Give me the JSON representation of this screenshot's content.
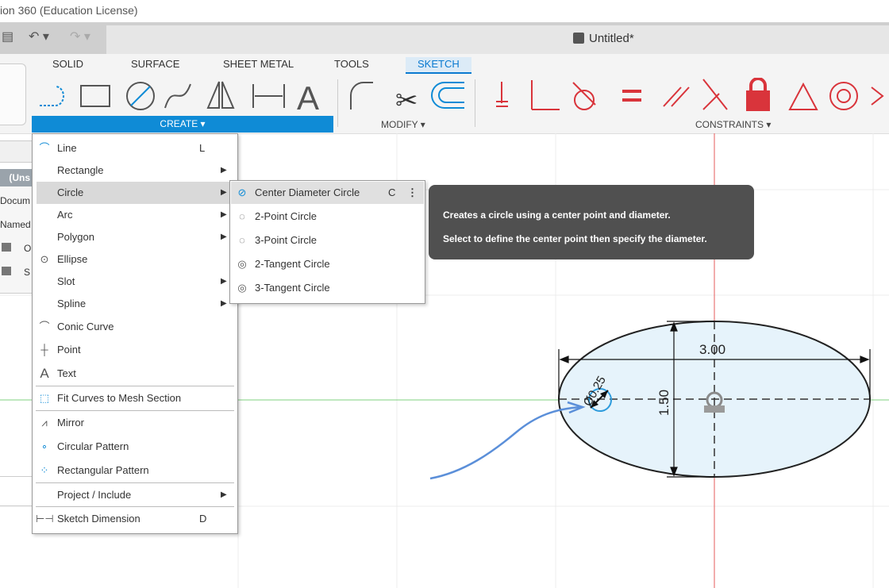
{
  "window": {
    "title_fragment": "ion 360 (Education License)",
    "document_title": "Untitled*"
  },
  "tabs": [
    {
      "label": "SOLID"
    },
    {
      "label": "SURFACE"
    },
    {
      "label": "SHEET METAL"
    },
    {
      "label": "TOOLS"
    },
    {
      "label": "SKETCH",
      "active": true
    }
  ],
  "panels": {
    "create": "CREATE ▾",
    "modify": "MODIFY ▾",
    "constraints": "CONSTRAINTS ▾"
  },
  "browser": {
    "header": "(Uns",
    "items": [
      "Docum",
      "Named",
      "O",
      "S"
    ]
  },
  "create_menu": {
    "items": [
      {
        "label": "Line",
        "shortcut": "L",
        "icon": "line-icon"
      },
      {
        "label": "Rectangle",
        "submenu": true
      },
      {
        "label": "Circle",
        "submenu": true,
        "highlighted": true
      },
      {
        "label": "Arc",
        "submenu": true
      },
      {
        "label": "Polygon",
        "submenu": true
      },
      {
        "label": "Ellipse",
        "icon": "ellipse-icon"
      },
      {
        "label": "Slot",
        "submenu": true
      },
      {
        "label": "Spline",
        "submenu": true
      },
      {
        "label": "Conic Curve",
        "icon": "conic-curve-icon"
      },
      {
        "label": "Point",
        "icon": "point-icon"
      },
      {
        "label": "Text",
        "icon": "text-icon"
      },
      {
        "label": "Fit Curves to Mesh Section",
        "icon": "fit-curves-icon"
      },
      {
        "label": "Mirror",
        "icon": "mirror-icon"
      },
      {
        "label": "Circular Pattern",
        "icon": "circular-pattern-icon"
      },
      {
        "label": "Rectangular Pattern",
        "icon": "rectangular-pattern-icon"
      },
      {
        "label": "Project / Include",
        "submenu": true
      },
      {
        "label": "Sketch Dimension",
        "shortcut": "D",
        "icon": "sketch-dimension-icon"
      }
    ]
  },
  "circle_menu": {
    "items": [
      {
        "label": "Center Diameter Circle",
        "shortcut": "C",
        "highlighted": true
      },
      {
        "label": "2-Point Circle"
      },
      {
        "label": "3-Point Circle"
      },
      {
        "label": "2-Tangent Circle"
      },
      {
        "label": "3-Tangent Circle"
      }
    ],
    "more": "⋮"
  },
  "tooltip": {
    "line1": "Creates a circle using a center point and diameter.",
    "line2": "Select to define the center point then specify the diameter."
  },
  "sketch": {
    "dim_width": "3.00",
    "dim_height": "1.50",
    "dim_circle": "Ø0.25"
  },
  "colors": {
    "accent": "#0f8bd6",
    "constraint_red": "#d9343b",
    "ellipse_fill": "#e6f3fb",
    "annotation_blue": "#4a86d8"
  }
}
